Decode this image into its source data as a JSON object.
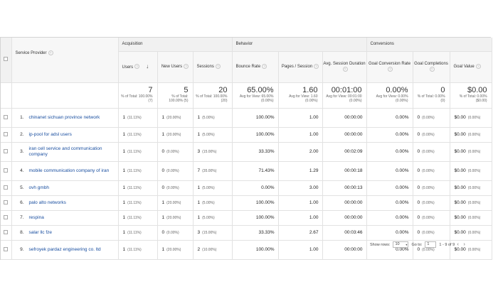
{
  "header": {
    "service_provider": "Service Provider",
    "groups": {
      "acquisition": "Acquisition",
      "behavior": "Behavior",
      "conversions": "Conversions"
    },
    "columns": {
      "users": "Users",
      "new_users": "New Users",
      "sessions": "Sessions",
      "bounce_rate": "Bounce Rate",
      "pages_session": "Pages / Session",
      "avg_session_duration": "Avg. Session Duration",
      "goal_conv_rate": "Goal Conversion Rate",
      "goal_completions": "Goal Completions",
      "goal_value": "Goal Value"
    }
  },
  "totals": {
    "users": {
      "value": "7",
      "sub": "% of Total: 100.00% (7)"
    },
    "new_users": {
      "value": "5",
      "sub": "% of Total: 100.00% (5)"
    },
    "sessions": {
      "value": "20",
      "sub": "% of Total: 100.00% (20)"
    },
    "bounce_rate": {
      "value": "65.00%",
      "sub": "Avg for View: 65.00% (0.00%)"
    },
    "pages_session": {
      "value": "1.60",
      "sub": "Avg for View: 1.60 (0.00%)"
    },
    "avg_session_duration": {
      "value": "00:01:00",
      "sub": "Avg for View: 00:01:00 (0.00%)"
    },
    "goal_conv_rate": {
      "value": "0.00%",
      "sub": "Avg for View: 0.00% (0.00%)"
    },
    "goal_completions": {
      "value": "0",
      "sub": "% of Total: 0.00% (0)"
    },
    "goal_value": {
      "value": "$0.00",
      "sub": "% of Total: 0.00% ($0.00)"
    }
  },
  "rows": [
    {
      "idx": "1.",
      "provider": "chinanet sichuan province network",
      "users": "1",
      "users_pct": "(11.11%)",
      "new_users": "1",
      "new_users_pct": "(20.00%)",
      "sessions": "1",
      "sessions_pct": "(5.00%)",
      "bounce": "100.00%",
      "pages": "1.00",
      "duration": "00:00:00",
      "conv": "0.00%",
      "goals": "0",
      "goals_pct": "(0.00%)",
      "value": "$0.00",
      "value_pct": "(0.00%)"
    },
    {
      "idx": "2.",
      "provider": "ip-pool for adsl users",
      "users": "1",
      "users_pct": "(11.11%)",
      "new_users": "1",
      "new_users_pct": "(20.00%)",
      "sessions": "1",
      "sessions_pct": "(5.00%)",
      "bounce": "100.00%",
      "pages": "1.00",
      "duration": "00:00:00",
      "conv": "0.00%",
      "goals": "0",
      "goals_pct": "(0.00%)",
      "value": "$0.00",
      "value_pct": "(0.00%)"
    },
    {
      "idx": "3.",
      "provider": "iran cell service and communication company",
      "users": "1",
      "users_pct": "(11.11%)",
      "new_users": "0",
      "new_users_pct": "(0.00%)",
      "sessions": "3",
      "sessions_pct": "(15.00%)",
      "bounce": "33.33%",
      "pages": "2.00",
      "duration": "00:02:09",
      "conv": "0.00%",
      "goals": "0",
      "goals_pct": "(0.00%)",
      "value": "$0.00",
      "value_pct": "(0.00%)"
    },
    {
      "idx": "4.",
      "provider": "mobile communication company of iran",
      "users": "1",
      "users_pct": "(11.11%)",
      "new_users": "0",
      "new_users_pct": "(0.00%)",
      "sessions": "7",
      "sessions_pct": "(35.00%)",
      "bounce": "71.43%",
      "pages": "1.29",
      "duration": "00:00:18",
      "conv": "0.00%",
      "goals": "0",
      "goals_pct": "(0.00%)",
      "value": "$0.00",
      "value_pct": "(0.00%)"
    },
    {
      "idx": "5.",
      "provider": "ovh gmbh",
      "users": "1",
      "users_pct": "(11.11%)",
      "new_users": "0",
      "new_users_pct": "(0.00%)",
      "sessions": "1",
      "sessions_pct": "(5.00%)",
      "bounce": "0.00%",
      "pages": "3.00",
      "duration": "00:00:13",
      "conv": "0.00%",
      "goals": "0",
      "goals_pct": "(0.00%)",
      "value": "$0.00",
      "value_pct": "(0.00%)"
    },
    {
      "idx": "6.",
      "provider": "palo alto networks",
      "users": "1",
      "users_pct": "(11.11%)",
      "new_users": "1",
      "new_users_pct": "(20.00%)",
      "sessions": "1",
      "sessions_pct": "(5.00%)",
      "bounce": "100.00%",
      "pages": "1.00",
      "duration": "00:00:00",
      "conv": "0.00%",
      "goals": "0",
      "goals_pct": "(0.00%)",
      "value": "$0.00",
      "value_pct": "(0.00%)"
    },
    {
      "idx": "7.",
      "provider": "respina",
      "users": "1",
      "users_pct": "(11.11%)",
      "new_users": "1",
      "new_users_pct": "(20.00%)",
      "sessions": "1",
      "sessions_pct": "(5.00%)",
      "bounce": "100.00%",
      "pages": "1.00",
      "duration": "00:00:00",
      "conv": "0.00%",
      "goals": "0",
      "goals_pct": "(0.00%)",
      "value": "$0.00",
      "value_pct": "(0.00%)"
    },
    {
      "idx": "8.",
      "provider": "salar llc fze",
      "users": "1",
      "users_pct": "(11.11%)",
      "new_users": "0",
      "new_users_pct": "(0.00%)",
      "sessions": "3",
      "sessions_pct": "(15.00%)",
      "bounce": "33.33%",
      "pages": "2.67",
      "duration": "00:03:46",
      "conv": "0.00%",
      "goals": "0",
      "goals_pct": "(0.00%)",
      "value": "$0.00",
      "value_pct": "(0.00%)"
    },
    {
      "idx": "9.",
      "provider": "sefroyek pardaz engineering co. ltd",
      "users": "1",
      "users_pct": "(11.11%)",
      "new_users": "1",
      "new_users_pct": "(20.00%)",
      "sessions": "2",
      "sessions_pct": "(10.00%)",
      "bounce": "100.00%",
      "pages": "1.00",
      "duration": "00:00:00",
      "conv": "0.00%",
      "goals": "0",
      "goals_pct": "(0.00%)",
      "value": "$0.00",
      "value_pct": "(0.00%)"
    }
  ],
  "footer": {
    "show_rows_label": "Show rows:",
    "show_rows_value": "10",
    "goto_label": "Go to:",
    "goto_value": "1",
    "range": "1 - 9 of 9",
    "prev_icon": "‹",
    "next_icon": "›"
  },
  "icons": {
    "help": "?",
    "sort_down": "↓",
    "caret": "▾"
  }
}
